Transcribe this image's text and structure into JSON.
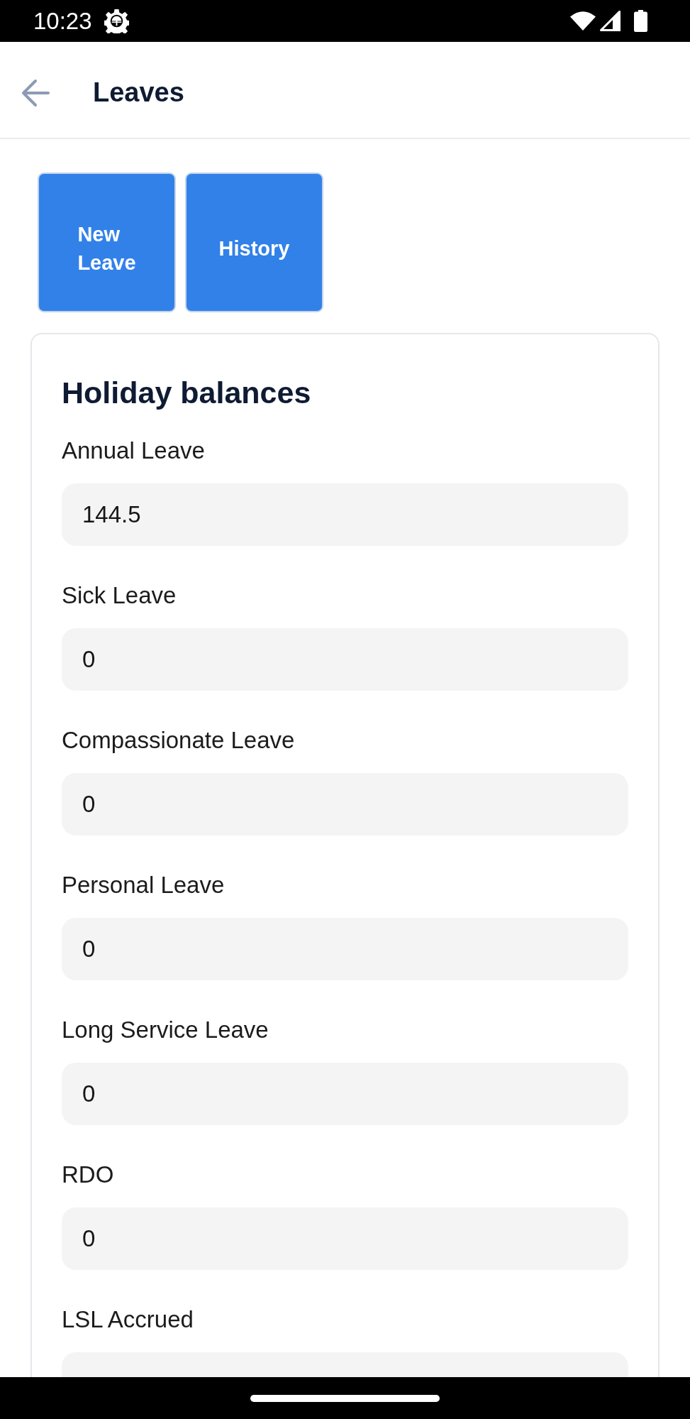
{
  "status_bar": {
    "time": "10:23"
  },
  "app_bar": {
    "title": "Leaves"
  },
  "actions": [
    {
      "label": "New Leave"
    },
    {
      "label": "History"
    }
  ],
  "balances": {
    "title": "Holiday balances",
    "fields": [
      {
        "label": "Annual Leave",
        "value": "144.5"
      },
      {
        "label": "Sick Leave",
        "value": "0"
      },
      {
        "label": "Compassionate Leave",
        "value": "0"
      },
      {
        "label": "Personal Leave",
        "value": "0"
      },
      {
        "label": "Long Service Leave",
        "value": "0"
      },
      {
        "label": "RDO",
        "value": "0"
      },
      {
        "label": "LSL Accrued"
      }
    ]
  }
}
